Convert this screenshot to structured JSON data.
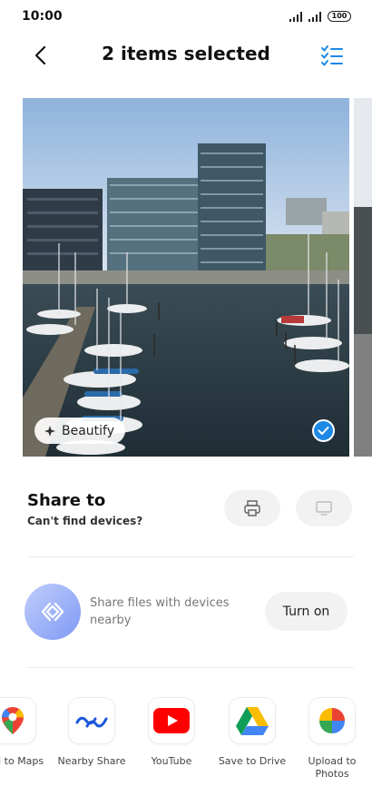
{
  "status_bar": {
    "time": "10:00",
    "battery": "100"
  },
  "header": {
    "title": "2 items selected",
    "back_icon": "chevron-left-icon",
    "select_all_icon": "checklist-icon"
  },
  "photo": {
    "beautify_label": "Beautify",
    "selected": true
  },
  "share_to": {
    "heading": "Share to",
    "subtitle": "Can't find devices?",
    "devices": [
      {
        "icon": "printer-icon"
      },
      {
        "icon": "monitor-icon"
      }
    ]
  },
  "nearby": {
    "text": "Share files with devices nearby",
    "button_label": "Turn on",
    "icon": "nearby-share-icon"
  },
  "apps": [
    {
      "label": "Add to Maps",
      "icon": "google-maps-icon"
    },
    {
      "label": "Nearby Share",
      "icon": "nearby-share-icon"
    },
    {
      "label": "YouTube",
      "icon": "youtube-icon"
    },
    {
      "label": "Save to Drive",
      "icon": "google-drive-icon"
    },
    {
      "label": "Upload to Photos",
      "icon": "google-photos-icon"
    }
  ],
  "colors": {
    "accent": "#1e88e5",
    "chip_bg": "#f2f2f2",
    "youtube_red": "#ff0000",
    "nearby_blue": "#1a56db"
  }
}
